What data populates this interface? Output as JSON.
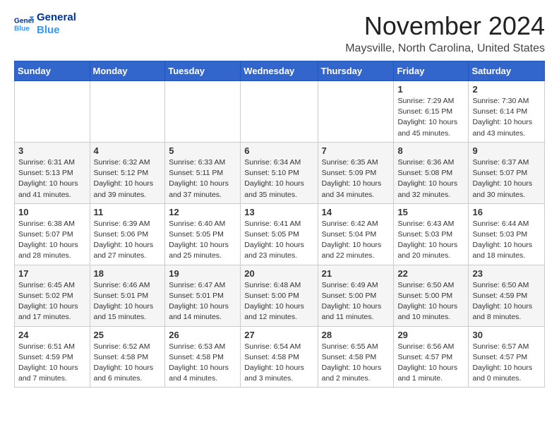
{
  "header": {
    "logo_line1": "General",
    "logo_line2": "Blue",
    "month": "November 2024",
    "location": "Maysville, North Carolina, United States"
  },
  "weekdays": [
    "Sunday",
    "Monday",
    "Tuesday",
    "Wednesday",
    "Thursday",
    "Friday",
    "Saturday"
  ],
  "weeks": [
    [
      {
        "day": "",
        "detail": ""
      },
      {
        "day": "",
        "detail": ""
      },
      {
        "day": "",
        "detail": ""
      },
      {
        "day": "",
        "detail": ""
      },
      {
        "day": "",
        "detail": ""
      },
      {
        "day": "1",
        "detail": "Sunrise: 7:29 AM\nSunset: 6:15 PM\nDaylight: 10 hours\nand 45 minutes."
      },
      {
        "day": "2",
        "detail": "Sunrise: 7:30 AM\nSunset: 6:14 PM\nDaylight: 10 hours\nand 43 minutes."
      }
    ],
    [
      {
        "day": "3",
        "detail": "Sunrise: 6:31 AM\nSunset: 5:13 PM\nDaylight: 10 hours\nand 41 minutes."
      },
      {
        "day": "4",
        "detail": "Sunrise: 6:32 AM\nSunset: 5:12 PM\nDaylight: 10 hours\nand 39 minutes."
      },
      {
        "day": "5",
        "detail": "Sunrise: 6:33 AM\nSunset: 5:11 PM\nDaylight: 10 hours\nand 37 minutes."
      },
      {
        "day": "6",
        "detail": "Sunrise: 6:34 AM\nSunset: 5:10 PM\nDaylight: 10 hours\nand 35 minutes."
      },
      {
        "day": "7",
        "detail": "Sunrise: 6:35 AM\nSunset: 5:09 PM\nDaylight: 10 hours\nand 34 minutes."
      },
      {
        "day": "8",
        "detail": "Sunrise: 6:36 AM\nSunset: 5:08 PM\nDaylight: 10 hours\nand 32 minutes."
      },
      {
        "day": "9",
        "detail": "Sunrise: 6:37 AM\nSunset: 5:07 PM\nDaylight: 10 hours\nand 30 minutes."
      }
    ],
    [
      {
        "day": "10",
        "detail": "Sunrise: 6:38 AM\nSunset: 5:07 PM\nDaylight: 10 hours\nand 28 minutes."
      },
      {
        "day": "11",
        "detail": "Sunrise: 6:39 AM\nSunset: 5:06 PM\nDaylight: 10 hours\nand 27 minutes."
      },
      {
        "day": "12",
        "detail": "Sunrise: 6:40 AM\nSunset: 5:05 PM\nDaylight: 10 hours\nand 25 minutes."
      },
      {
        "day": "13",
        "detail": "Sunrise: 6:41 AM\nSunset: 5:05 PM\nDaylight: 10 hours\nand 23 minutes."
      },
      {
        "day": "14",
        "detail": "Sunrise: 6:42 AM\nSunset: 5:04 PM\nDaylight: 10 hours\nand 22 minutes."
      },
      {
        "day": "15",
        "detail": "Sunrise: 6:43 AM\nSunset: 5:03 PM\nDaylight: 10 hours\nand 20 minutes."
      },
      {
        "day": "16",
        "detail": "Sunrise: 6:44 AM\nSunset: 5:03 PM\nDaylight: 10 hours\nand 18 minutes."
      }
    ],
    [
      {
        "day": "17",
        "detail": "Sunrise: 6:45 AM\nSunset: 5:02 PM\nDaylight: 10 hours\nand 17 minutes."
      },
      {
        "day": "18",
        "detail": "Sunrise: 6:46 AM\nSunset: 5:01 PM\nDaylight: 10 hours\nand 15 minutes."
      },
      {
        "day": "19",
        "detail": "Sunrise: 6:47 AM\nSunset: 5:01 PM\nDaylight: 10 hours\nand 14 minutes."
      },
      {
        "day": "20",
        "detail": "Sunrise: 6:48 AM\nSunset: 5:00 PM\nDaylight: 10 hours\nand 12 minutes."
      },
      {
        "day": "21",
        "detail": "Sunrise: 6:49 AM\nSunset: 5:00 PM\nDaylight: 10 hours\nand 11 minutes."
      },
      {
        "day": "22",
        "detail": "Sunrise: 6:50 AM\nSunset: 5:00 PM\nDaylight: 10 hours\nand 10 minutes."
      },
      {
        "day": "23",
        "detail": "Sunrise: 6:50 AM\nSunset: 4:59 PM\nDaylight: 10 hours\nand 8 minutes."
      }
    ],
    [
      {
        "day": "24",
        "detail": "Sunrise: 6:51 AM\nSunset: 4:59 PM\nDaylight: 10 hours\nand 7 minutes."
      },
      {
        "day": "25",
        "detail": "Sunrise: 6:52 AM\nSunset: 4:58 PM\nDaylight: 10 hours\nand 6 minutes."
      },
      {
        "day": "26",
        "detail": "Sunrise: 6:53 AM\nSunset: 4:58 PM\nDaylight: 10 hours\nand 4 minutes."
      },
      {
        "day": "27",
        "detail": "Sunrise: 6:54 AM\nSunset: 4:58 PM\nDaylight: 10 hours\nand 3 minutes."
      },
      {
        "day": "28",
        "detail": "Sunrise: 6:55 AM\nSunset: 4:58 PM\nDaylight: 10 hours\nand 2 minutes."
      },
      {
        "day": "29",
        "detail": "Sunrise: 6:56 AM\nSunset: 4:57 PM\nDaylight: 10 hours\nand 1 minute."
      },
      {
        "day": "30",
        "detail": "Sunrise: 6:57 AM\nSunset: 4:57 PM\nDaylight: 10 hours\nand 0 minutes."
      }
    ]
  ]
}
